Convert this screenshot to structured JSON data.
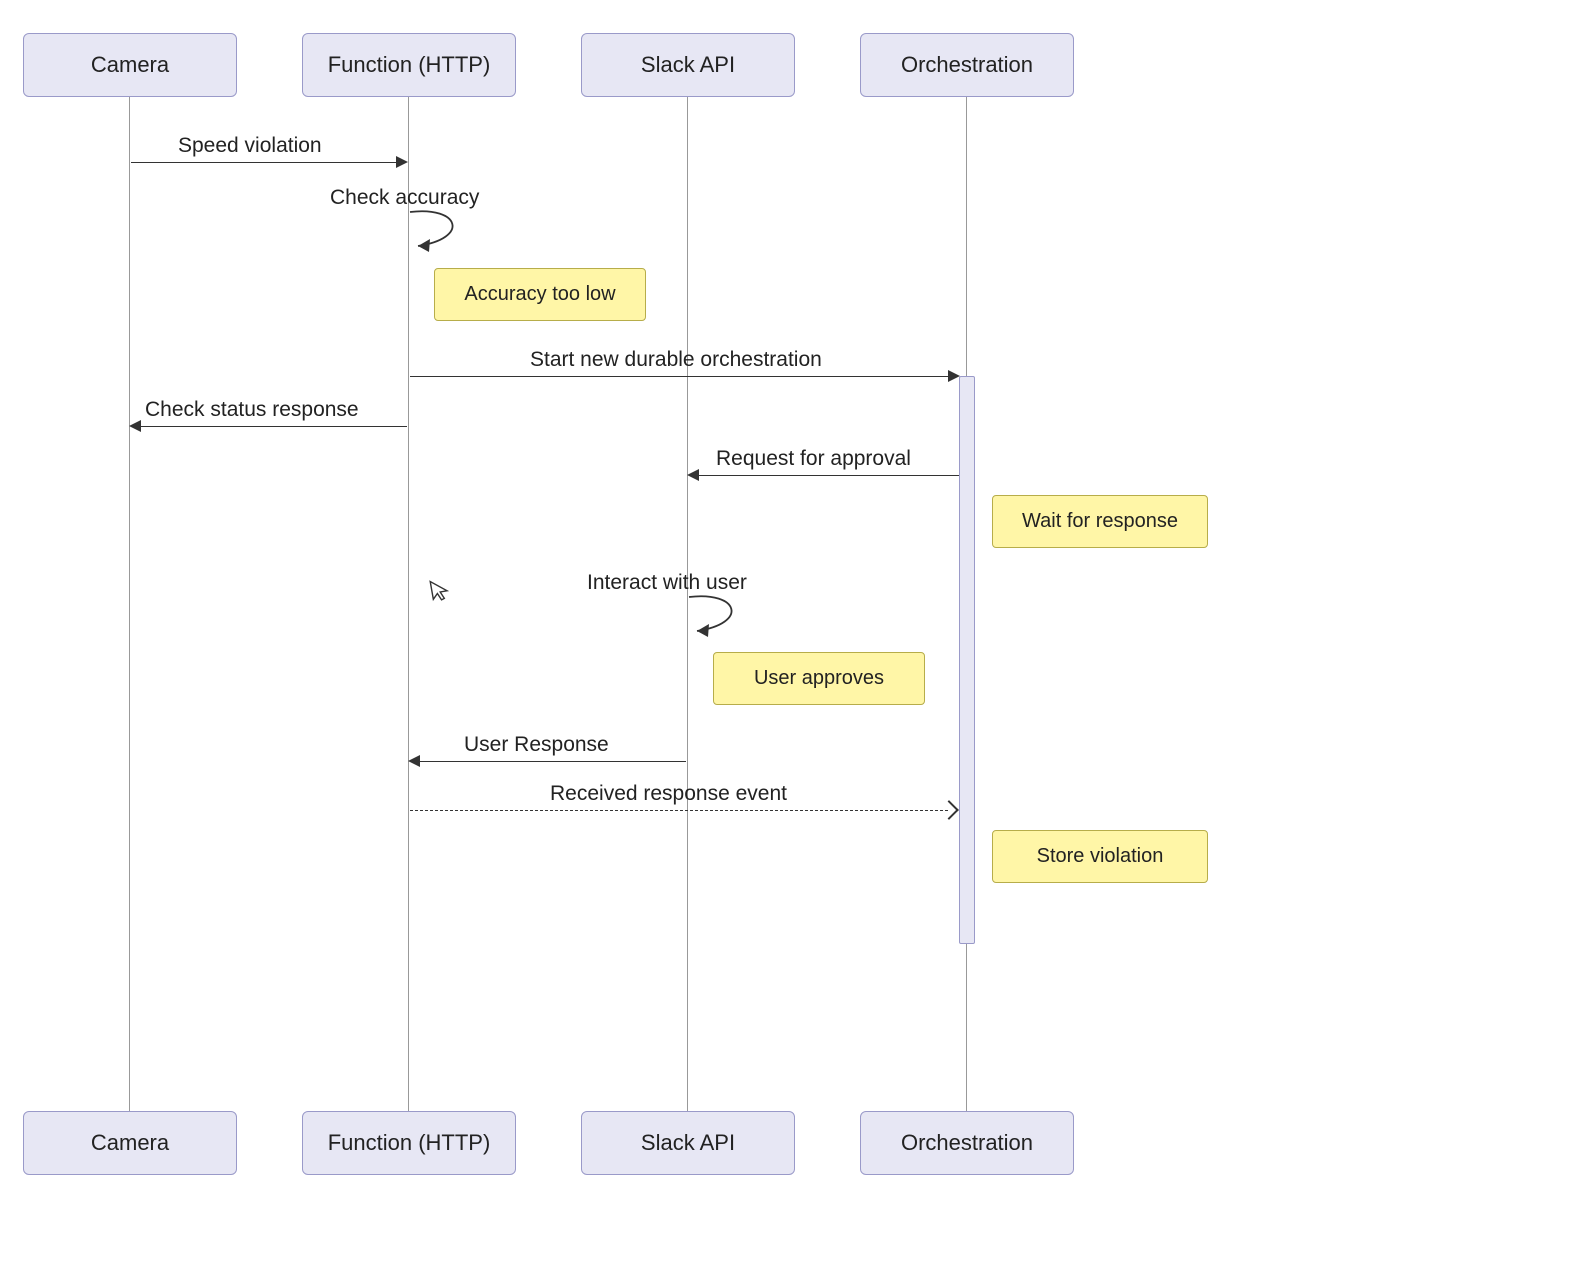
{
  "chart_data": {
    "type": "sequence-diagram",
    "participants": [
      "Camera",
      "Function (HTTP)",
      "Slack API",
      "Orchestration"
    ],
    "messages": [
      {
        "from": "Camera",
        "to": "Function (HTTP)",
        "label": "Speed violation",
        "style": "solid"
      },
      {
        "from": "Function (HTTP)",
        "to": "Function (HTTP)",
        "label": "Check accuracy",
        "style": "self"
      },
      {
        "note_over": "Function (HTTP)",
        "text": "Accuracy too low"
      },
      {
        "from": "Function (HTTP)",
        "to": "Orchestration",
        "label": "Start new durable orchestration",
        "style": "solid",
        "activate": "Orchestration"
      },
      {
        "from": "Function (HTTP)",
        "to": "Camera",
        "label": "Check status response",
        "style": "solid"
      },
      {
        "from": "Orchestration",
        "to": "Slack API",
        "label": "Request for approval",
        "style": "solid"
      },
      {
        "note_right_of": "Orchestration",
        "text": "Wait for response"
      },
      {
        "from": "Slack API",
        "to": "Slack API",
        "label": "Interact with user",
        "style": "self"
      },
      {
        "note_over": "Slack API",
        "text": "User approves"
      },
      {
        "from": "Slack API",
        "to": "Function (HTTP)",
        "label": "User Response",
        "style": "solid"
      },
      {
        "from": "Function (HTTP)",
        "to": "Orchestration",
        "label": "Received response event",
        "style": "dashed"
      },
      {
        "note_right_of": "Orchestration",
        "text": "Store violation",
        "deactivate": "Orchestration"
      }
    ]
  },
  "participants": {
    "p0": "Camera",
    "p1": "Function (HTTP)",
    "p2": "Slack API",
    "p3": "Orchestration"
  },
  "labels": {
    "m_speed_violation": "Speed violation",
    "m_check_accuracy": "Check accuracy",
    "m_start_orch": "Start new durable orchestration",
    "m_check_status": "Check status response",
    "m_req_approval": "Request for approval",
    "m_interact_user": "Interact with user",
    "m_user_response": "User Response",
    "m_received_event": "Received response event"
  },
  "notes": {
    "n_accuracy_low": "Accuracy too low",
    "n_wait_response": "Wait for response",
    "n_user_approves": "User approves",
    "n_store_violation": "Store violation"
  }
}
